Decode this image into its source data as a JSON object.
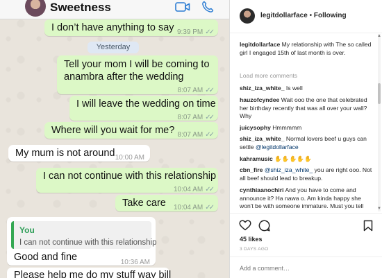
{
  "chat": {
    "contact_name": "Sweetness",
    "day_divider": "Yesterday",
    "messages": [
      {
        "text": "I don’t have anything to say",
        "time": "9:39 PM",
        "ticks": "✓✓"
      },
      {
        "line1": "Tell your mom I will be coming to",
        "line2": "anambra after the wedding",
        "time": "8:07 AM",
        "ticks": "✓✓"
      },
      {
        "text": "I will leave the wedding on time",
        "time": "8:07 AM",
        "ticks": "✓✓"
      },
      {
        "text": "Where will you wait for me?",
        "time": "8:07 AM",
        "ticks": "✓✓"
      },
      {
        "text": "My mum is not around",
        "time": "10:00 AM"
      },
      {
        "text": "I can not continue with this relationship",
        "time": "10:04 AM",
        "ticks": "✓✓"
      },
      {
        "text": "Take care",
        "time": "10:04 AM",
        "ticks": "✓✓"
      },
      {
        "quote_author": "You",
        "quote_text": "I can not continue with this relationship",
        "text": "Good and fine",
        "time": "10:36 AM"
      },
      {
        "text": "Please help me do my stuff way bill"
      }
    ]
  },
  "instagram": {
    "username": "legitdollarface",
    "separator": "•",
    "follow_label": "Following",
    "caption_user": "legitdollarface",
    "caption": "My relationship with The so called girl I engaged 15th of last month is over.",
    "load_more": "Load more comments",
    "comments": [
      {
        "user": "shiz_iza_white_",
        "text": "Is well"
      },
      {
        "user": "hauzofcyndee",
        "text": "Wait ooo the one that celebrated her birthday recently that was all over your wall? Why"
      },
      {
        "user": "juicysophy",
        "text": "Hmmmmm"
      },
      {
        "user": "shiz_iza_white_",
        "text": "Normal lovers beef u guys can settle",
        "mention": "@legitdollarface"
      },
      {
        "user": "kahramusic",
        "text": "✋✋✋✋✋"
      },
      {
        "user": "cbn_fire",
        "mention": "@shiz_iza_white_",
        "text": "you are right ooo. Not all beef should lead to breakup."
      },
      {
        "user": "cynthiaanochiri",
        "text": "And you have to come and announce it? Ha nawa o. Am kinda happy she won't be with someone immature."
      },
      {
        "user": "",
        "text": "Must you tell the world everything?"
      }
    ],
    "likes": "45 likes",
    "time_ago": "3 DAYS AGO",
    "add_comment_placeholder": "Add a comment…",
    "icons": [
      "heart-icon",
      "comment-icon",
      "bookmark-icon"
    ]
  },
  "colors": {
    "outgoing_bubble": "#dcf8c6",
    "incoming_bubble": "#ffffff",
    "quote_accent": "#34a853",
    "mention": "#003569"
  }
}
